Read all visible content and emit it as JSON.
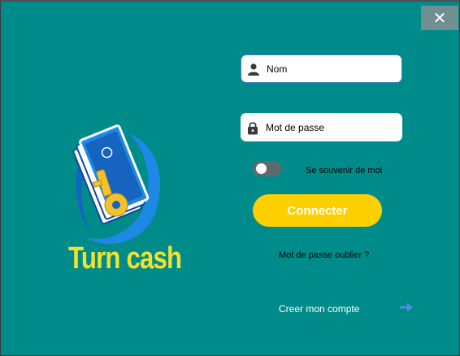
{
  "window": {
    "close_glyph": "✕"
  },
  "brand": {
    "name": "Turn cash"
  },
  "form": {
    "username_placeholder": "Nom",
    "password_placeholder": "Mot de passe",
    "remember_label": "Se souvenir de moi",
    "remember_on": false,
    "connect_label": "Connecter",
    "forgot_label": "Mot de passe oublier ?",
    "create_label": "Creer mon compte"
  },
  "icons": {
    "username": "user-icon",
    "password": "lock-icon",
    "create": "arrow-right-icon"
  },
  "colors": {
    "background": "#008b8b",
    "accent": "#ffd000",
    "brand_text": "#f2e22a",
    "arrow": "#4a90e2"
  }
}
